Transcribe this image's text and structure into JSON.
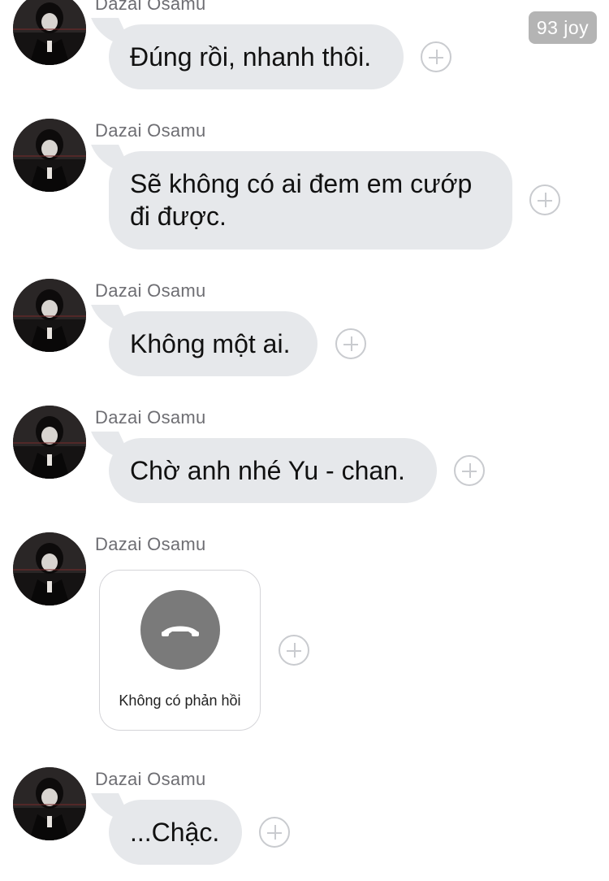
{
  "watermark": "93 joy",
  "avatar_icon": "anime-character-avatar",
  "messages": [
    {
      "sender": "Dazai Osamu",
      "text": "Đúng rồi, nhanh thôi."
    },
    {
      "sender": "Dazai Osamu",
      "text": "Sẽ không có ai đem em cướp đi được."
    },
    {
      "sender": "Dazai Osamu",
      "text": "Không một ai."
    },
    {
      "sender": "Dazai Osamu",
      "text": "Chờ anh nhé Yu - chan."
    },
    {
      "sender": "Dazai Osamu",
      "call_status": "Không có phản hồi"
    },
    {
      "sender": "Dazai Osamu",
      "text": "...Chậc."
    }
  ],
  "colors": {
    "bubble": "#e6e8eb",
    "sender_text": "#6e6e73",
    "call_icon_bg": "#7a7a7a"
  }
}
